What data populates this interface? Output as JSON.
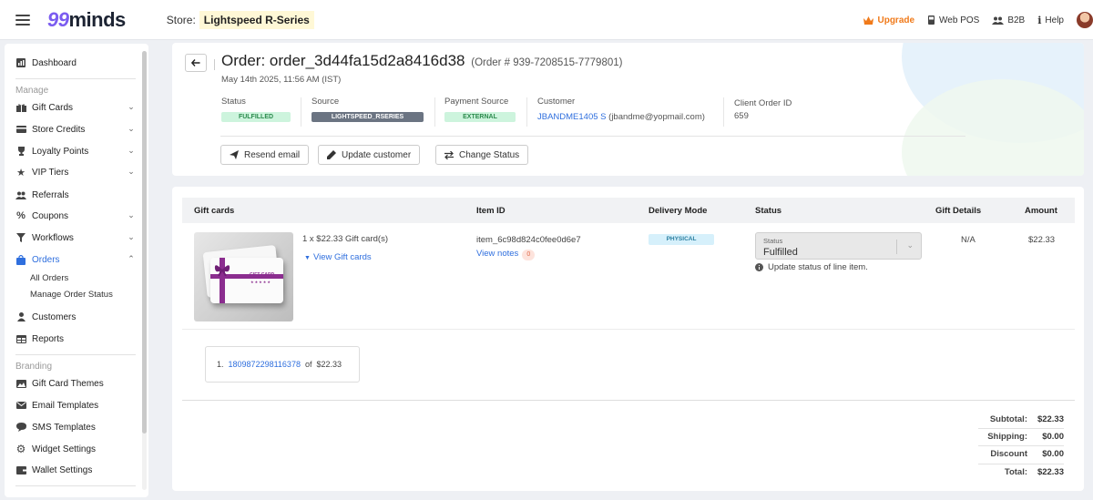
{
  "header": {
    "logo_num": "99",
    "logo_word": "minds",
    "store_label": "Store:",
    "store_name": "Lightspeed R-Series",
    "nav": {
      "upgrade": "Upgrade",
      "webpos": "Web POS",
      "b2b": "B2B",
      "help": "Help"
    }
  },
  "sidebar": {
    "dashboard": "Dashboard",
    "manage_section": "Manage",
    "gift_cards": "Gift Cards",
    "store_credits": "Store Credits",
    "loyalty_points": "Loyalty Points",
    "vip_tiers": "VIP Tiers",
    "referrals": "Referrals",
    "coupons": "Coupons",
    "workflows": "Workflows",
    "orders": "Orders",
    "all_orders": "All Orders",
    "manage_order_status": "Manage Order Status",
    "customers": "Customers",
    "reports": "Reports",
    "branding_section": "Branding",
    "gift_card_themes": "Gift Card Themes",
    "email_templates": "Email Templates",
    "sms_templates": "SMS Templates",
    "widget_settings": "Widget Settings",
    "wallet_settings": "Wallet Settings"
  },
  "order": {
    "title": "Order: order_3d44fa15d2a8416d38",
    "number": "(Order # 939-7208515-7779801)",
    "date": "May 14th 2025, 11:56 AM (IST)",
    "status_label": "Status",
    "status_value": "FULFILLED",
    "source_label": "Source",
    "source_value": "LIGHTSPEED_RSERIES",
    "payment_label": "Payment Source",
    "payment_value": "EXTERNAL",
    "customer_label": "Customer",
    "customer_value": "JBANDME1405 S",
    "customer_email": "(jbandme@yopmail.com)",
    "client_order_label": "Client Order ID",
    "client_order_value": "659",
    "actions": {
      "resend": "Resend email",
      "update_customer": "Update customer",
      "change_status": "Change Status"
    }
  },
  "items": {
    "columns": [
      "Gift cards",
      "Item ID",
      "Delivery Mode",
      "Status",
      "Gift Details",
      "Amount"
    ],
    "row": {
      "card_image_text": "GIFT CARD",
      "card_image_stars": "★★★★★",
      "quantity_desc": "1 x $22.33 Gift card(s)",
      "view_gift_cards": "View Gift cards",
      "item_id": "item_6c98d824c0fee0d6e7",
      "view_notes": "View notes",
      "notes_count": "0",
      "delivery_mode": "PHYSICAL",
      "status_select_label": "Status",
      "status_select_value": "Fulfilled",
      "status_hint": "Update status of line item.",
      "gift_details": "N/A",
      "amount": "$22.33"
    },
    "codes": [
      {
        "index": "1.",
        "code": "1809872298116378",
        "of": "of",
        "value": "$22.33"
      }
    ]
  },
  "totals": [
    {
      "label": "Subtotal:",
      "value": "$22.33"
    },
    {
      "label": "Shipping:",
      "value": "$0.00"
    },
    {
      "label": "Discount",
      "value": "$0.00"
    },
    {
      "label": "Total:",
      "value": "$22.33"
    }
  ],
  "colors": {
    "accent": "#2f6fde",
    "upgrade": "#f07a1a",
    "brand": "#7b5cf0"
  }
}
